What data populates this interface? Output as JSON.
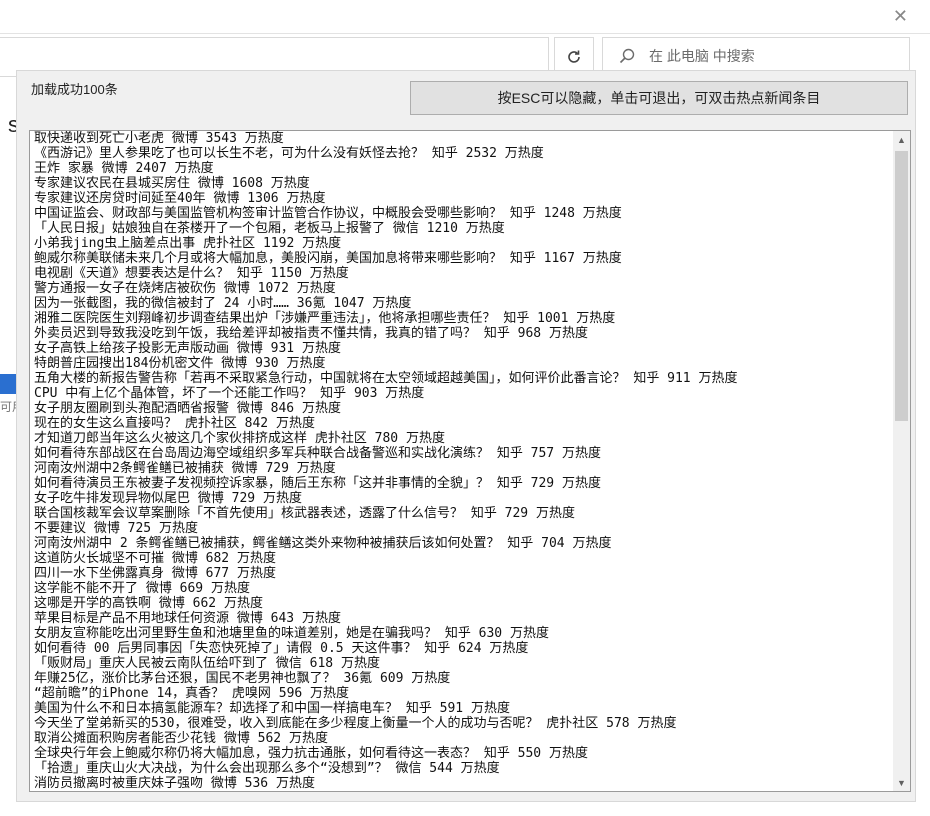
{
  "background_window": {
    "search_placeholder": "在 此电脑 中搜索",
    "side_glyph": "s",
    "side_grey_text": "可用"
  },
  "popup": {
    "status_text": "加载成功100条",
    "hint_button_label": "按ESC可以隐藏，单击可退出，可双击热点新闻条目",
    "items": [
      "取快递收到死亡小老虎 微博 3543 万热度",
      "《西游记》里人参果吃了也可以长生不老，可为什么没有妖怪去抢？ 知乎 2532 万热度",
      "王炸 家暴 微博 2407 万热度",
      "专家建议农民在县城买房住 微博 1608 万热度",
      "专家建议还房贷时间延至40年 微博 1306 万热度",
      "中国证监会、财政部与美国监管机构签审计监管合作协议，中概股会受哪些影响？ 知乎 1248 万热度",
      "「人民日报」姑娘独自在茶楼开了一个包厢，老板马上报警了 微信 1210 万热度",
      "小弟我jing虫上脑差点出事 虎扑社区 1192 万热度",
      "鲍威尔称美联储未来几个月或将大幅加息，美股闪崩，美国加息将带来哪些影响？ 知乎 1167 万热度",
      "电视剧《天道》想要表达是什么？ 知乎 1150 万热度",
      "警方通报一女子在烧烤店被砍伤 微博 1072 万热度",
      "因为一张截图，我的微信被封了 24 小时…… 36氪 1047 万热度",
      "湘雅二医院医生刘翔峰初步调查结果出炉「涉嫌严重违法」，他将承担哪些责任？ 知乎 1001 万热度",
      "外卖员迟到导致我没吃到午饭，我给差评却被指责不懂共情，我真的错了吗？ 知乎 968 万热度",
      "女子高铁上给孩子投影无声版动画 微博 931 万热度",
      "特朗普庄园搜出184份机密文件 微博 930 万热度",
      "五角大楼的新报告警告称「若再不采取紧急行动，中国就将在太空领域超越美国」，如何评价此番言论？ 知乎 911 万热度",
      "CPU 中有上亿个晶体管，坏了一个还能工作吗？ 知乎 903 万热度",
      "女子朋友圈刷到头孢配酒晒省报警 微博 846 万热度",
      "现在的女生这么直接吗？ 虎扑社区 842 万热度",
      "才知道刀郎当年这么火被这几个家伙排挤成这样 虎扑社区 780 万热度",
      "如何看待东部战区在台岛周边海空域组织多军兵种联合战备警巡和实战化演练？ 知乎 757 万热度",
      "河南汝州湖中2条鳄雀鳝已被捕获 微博 729 万热度",
      "如何看待演员王东被妻子发视频控诉家暴，随后王东称「这并非事情的全貌」？ 知乎 729 万热度",
      "女子吃牛排发现异物似尾巴 微博 729 万热度",
      "联合国核裁军会议草案删除「不首先使用」核武器表述，透露了什么信号？ 知乎 729 万热度",
      "不要建议 微博 725 万热度",
      "河南汝州湖中 2 条鳄雀鳝已被捕获，鳄雀鳝这类外来物种被捕获后该如何处置？ 知乎 704 万热度",
      "这道防火长城坚不可摧 微博 682 万热度",
      "四川一水下坐佛露真身 微博 677 万热度",
      "这学能不能不开了 微博 669 万热度",
      "这哪是开学的高铁啊 微博 662 万热度",
      "苹果目标是产品不用地球任何资源 微博 643 万热度",
      "女朋友宣称能吃出河里野生鱼和池塘里鱼的味道差别，她是在骗我吗？ 知乎 630 万热度",
      "如何看待 00 后男同事因「失恋快死掉了」请假 0.5 天这件事？ 知乎 624 万热度",
      "「贩财局」重庆人民被云南队伍给吓到了 微信 618 万热度",
      "年赚25亿，涨价比茅台还狠，国民不老男神也飘了？ 36氪 609 万热度",
      "“超前瞻”的iPhone 14，真香？ 虎嗅网 596 万热度",
      "美国为什么不和日本搞氢能源车？却选择了和中国一样搞电车？ 知乎 591 万热度",
      "今天坐了堂弟新买的530，很难受，收入到底能在多少程度上衡量一个人的成功与否呢？ 虎扑社区 578 万热度",
      "取消公摊面积购房者能否少花钱 微博 562 万热度",
      "全球央行年会上鲍威尔称仍将大幅加息，强力抗击通胀，如何看待这一表态？ 知乎 550 万热度",
      "「拾遗」重庆山火大决战，为什么会出现那么多个“没想到”？ 微信 544 万热度",
      "消防员撤离时被重庆妹子强吻 微博 536 万热度"
    ]
  }
}
